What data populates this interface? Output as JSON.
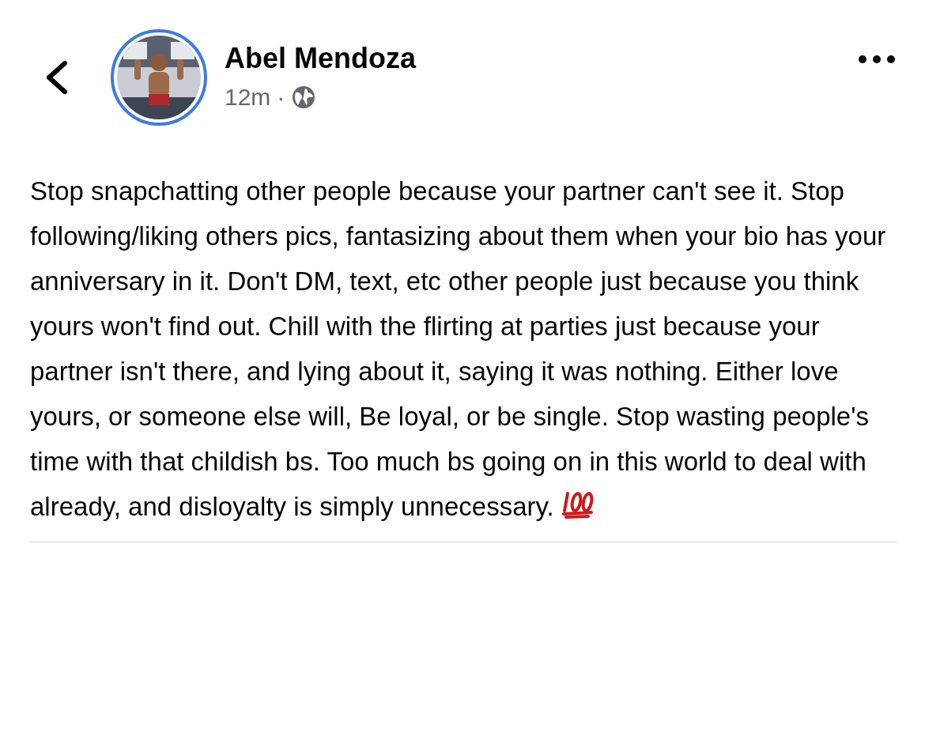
{
  "post": {
    "author": "Abel Mendoza",
    "time": "12m",
    "dot": "·",
    "text": "Stop snapchatting other people because your partner can't see it. Stop following/liking others pics, fantasizing about them when your bio has your anniversary in it. Don't DM, text, etc other people just because you think yours won't find out. Chill with the flirting at parties just because your partner isn't there, and lying about it, saying it was nothing. Either love yours, or someone else will, Be loyal, or be single. Stop wasting people's time with that childish bs. Too much bs going on in this world to deal with already, and disloyalty is simply unnecessary."
  }
}
